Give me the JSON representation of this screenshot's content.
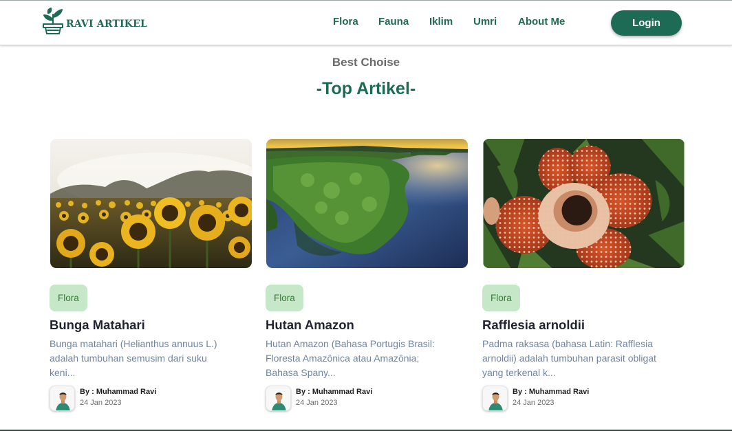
{
  "brand": {
    "name": "RAVI ARTIKEL",
    "icon": "plant-sprout-icon"
  },
  "nav": {
    "items": [
      {
        "label": "Flora"
      },
      {
        "label": "Fauna"
      },
      {
        "label": "Iklim"
      },
      {
        "label": "Umri"
      },
      {
        "label": "About Me"
      }
    ],
    "login_label": "Login"
  },
  "colors": {
    "primary": "#1e6b55",
    "tag_bg": "#c6e8c8",
    "tag_text": "#2e7d32",
    "excerpt": "#6f84a0"
  },
  "section": {
    "subtitle": "Best Choise",
    "title": "-Top Artikel-"
  },
  "articles": [
    {
      "image": "sunflower-field-photo",
      "tag": "Flora",
      "title": "Bunga Matahari",
      "excerpt": "Bunga matahari (Helianthus annuus L.) adalah tumbuhan semusim dari suku keni...",
      "author": "By : Muhammad Ravi",
      "date": "24 Jan 2023"
    },
    {
      "image": "amazon-forest-aerial-photo",
      "tag": "Flora",
      "title": "Hutan Amazon",
      "excerpt": "Hutan Amazon (Bahasa Portugis Brasil: Floresta Amazônica atau Amazônia; Bahasa Spany...",
      "author": "By : Muhammad Ravi",
      "date": "24 Jan 2023"
    },
    {
      "image": "rafflesia-flower-photo",
      "tag": "Flora",
      "title": "Rafflesia arnoldii",
      "excerpt": "Padma raksasa (bahasa Latin: Rafflesia arnoldii) adalah tumbuhan parasit obligat yang terkenal k...",
      "author": "By : Muhammad Ravi",
      "date": "24 Jan 2023"
    }
  ]
}
